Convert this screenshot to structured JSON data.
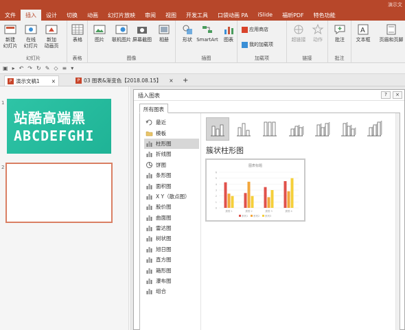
{
  "window": {
    "title_fragment": "演示文"
  },
  "menu_tabs": [
    "文件",
    "插入",
    "设计",
    "切换",
    "动画",
    "幻灯片放映",
    "审阅",
    "视图",
    "开发工具",
    "口袋动画 PA",
    "iSlide",
    "福昕PDF",
    "特色功能"
  ],
  "ribbon": {
    "groups": {
      "slides": "幻灯片",
      "tables": "表格",
      "images": "图像",
      "illustrations": "插图",
      "addins": "加载项",
      "links": "链接",
      "comments": "批注"
    },
    "buttons": {
      "new_slide": "新建\n幻灯片",
      "online_slide": "在线\n幻灯片",
      "new_anim_page": "新加\n动画页",
      "table": "表格",
      "picture": "图片",
      "online_picture": "联机图片",
      "screenshot": "屏幕截图",
      "album": "相册",
      "shapes": "形状",
      "smartart": "SmartArt",
      "chart": "图表",
      "store": "应用商店",
      "my_addins": "我的加载项",
      "hyperlink": "超链接",
      "action": "动作",
      "comment": "批注",
      "textbox": "文本框",
      "header_footer": "页眉和页脚"
    }
  },
  "doc_tabs": [
    {
      "label": "演示文稿1",
      "close": "×"
    },
    {
      "label": "03 图表&渐变色【2018.08.15】",
      "close": "×"
    }
  ],
  "doc_tab_add": "+",
  "thumbnails": {
    "slide1_num": "1",
    "slide2_num": "2",
    "slide1_line1": "站酷高端黑",
    "slide1_line2": "ABCDEFGHI"
  },
  "dialog": {
    "title": "插入图表",
    "help": "?",
    "close": "×",
    "tab": "所有图表",
    "chart_types": [
      "最近",
      "模板",
      "柱形图",
      "折线图",
      "饼图",
      "条形图",
      "面积图",
      "X Y（散点图）",
      "股价图",
      "曲面图",
      "雷达图",
      "树状图",
      "旭日图",
      "直方图",
      "箱形图",
      "瀑布图",
      "组合"
    ],
    "selected_type_index": 2,
    "selected_subtype_index": 0,
    "subtype_heading": "簇状柱形图",
    "preview_title": "图表标题"
  },
  "chart_data": {
    "type": "bar",
    "title": "图表标题",
    "categories": [
      "类别 1",
      "类别 2",
      "类别 3",
      "类别 4"
    ],
    "series": [
      {
        "name": "系列1",
        "values": [
          4.3,
          2.5,
          3.5,
          4.5
        ],
        "color": "#e0514b"
      },
      {
        "name": "系列2",
        "values": [
          2.4,
          4.4,
          1.8,
          2.8
        ],
        "color": "#f2a63b"
      },
      {
        "name": "系列3",
        "values": [
          2,
          2,
          3,
          5
        ],
        "color": "#f5cf3a"
      }
    ],
    "ylim": [
      0,
      6
    ],
    "grid": true,
    "legend": "bottom"
  }
}
